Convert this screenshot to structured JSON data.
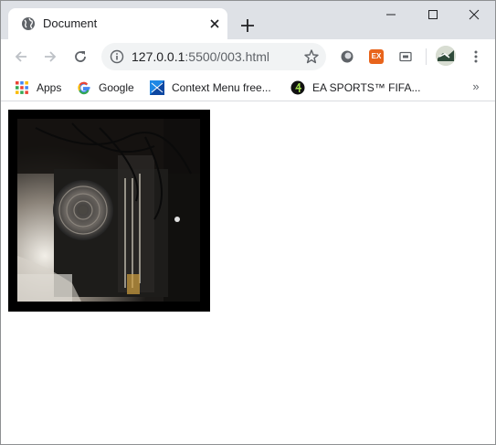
{
  "browser": {
    "tab": {
      "title": "Document",
      "favicon": "globe-icon"
    },
    "new_tab_icon": "plus-icon",
    "window_controls": [
      "minimize-icon",
      "maximize-icon",
      "close-icon"
    ],
    "toolbar": {
      "back_icon": "arrow-left-icon",
      "forward_icon": "arrow-right-icon",
      "reload_icon": "reload-icon",
      "url_host": "127.0.0.1",
      "url_path": ":5500/003.html",
      "info_icon": "info-icon",
      "bookmark_star_icon": "star-icon",
      "extensions": [
        "circle-extension-icon",
        "ex-extension-icon",
        "cast-extension-icon"
      ],
      "ex_extension_label": "EX",
      "profile_icon": "avatar",
      "menu_icon": "kebab-menu-icon"
    },
    "bookmarks": [
      {
        "label": "Apps",
        "icon": "apps-grid-icon"
      },
      {
        "label": "Google",
        "icon": "google-icon"
      },
      {
        "label": "Context Menu free...",
        "icon": "windows-icon"
      },
      {
        "label": "EA SPORTS™ FIFA...",
        "icon": "fifa-icon"
      }
    ],
    "bookmarks_overflow": "»"
  },
  "page": {
    "image": {
      "description_icon": "computer-interior-photo",
      "border_color": "#000000"
    }
  },
  "colors": {
    "tabstrip": "#dee1e6",
    "omnibox": "#f1f3f4",
    "text": "#202124",
    "icon_gray": "#5f6368"
  }
}
